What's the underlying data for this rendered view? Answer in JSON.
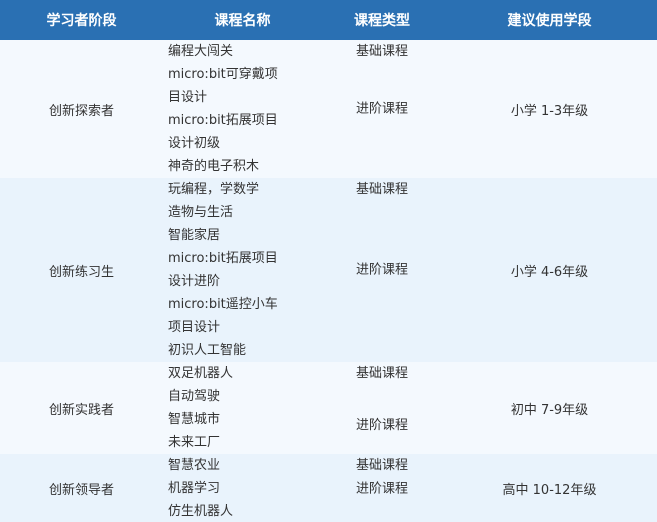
{
  "headers": {
    "stage": "学习者阶段",
    "course": "课程名称",
    "type": "课程类型",
    "grade": "建议使用学段"
  },
  "rows": [
    {
      "stage": "创新探索者",
      "course_lines": [
        "编程大闯关",
        "micro:bit可穿戴项",
        "目设计",
        "micro:bit拓展项目",
        "设计初级",
        "神奇的电子积木"
      ],
      "types": [
        "基础课程",
        "进阶课程"
      ],
      "grade": "小学 1-3年级"
    },
    {
      "stage": "创新练习生",
      "course_lines": [
        "玩编程，学数学",
        "造物与生活",
        "智能家居",
        "micro:bit拓展项目",
        "设计进阶",
        "micro:bit遥控小车",
        "项目设计",
        "初识人工智能"
      ],
      "types": [
        "基础课程",
        "进阶课程"
      ],
      "grade": "小学 4-6年级"
    },
    {
      "stage": "创新实践者",
      "course_lines": [
        "双足机器人",
        "自动驾驶",
        "智慧城市",
        "未来工厂"
      ],
      "types": [
        "基础课程",
        "进阶课程"
      ],
      "grade": "初中 7-9年级"
    },
    {
      "stage": "创新领导者",
      "course_lines": [
        "智慧农业",
        "机器学习",
        "仿生机器人"
      ],
      "types": [
        "基础课程",
        "进阶课程"
      ],
      "grade": "高中 10-12年级"
    }
  ]
}
